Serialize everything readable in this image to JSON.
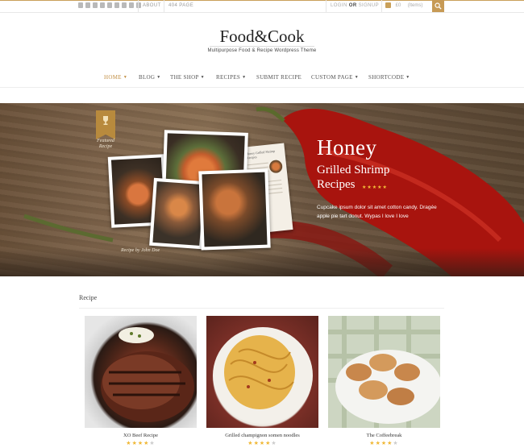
{
  "topbar": {
    "social_icons": [
      "rss-icon",
      "linkedin-icon",
      "pinterest-icon",
      "twitter-icon",
      "facebook-icon",
      "youtube-icon",
      "email-icon",
      "flickr-icon",
      "googleplus-icon"
    ],
    "links": [
      "ABOUT",
      "404 PAGE"
    ],
    "login": "LOGIN",
    "or": "OR",
    "signup": "SIGNUP",
    "cart_amount": "£0",
    "cart_items": "(Items)",
    "accent": "#c79a55"
  },
  "brand": {
    "logo": "Food&Cook",
    "tagline": "Multipurpose Food & Recipe Wordpress Theme"
  },
  "nav": [
    {
      "label": "HOME",
      "caret": true,
      "active": true
    },
    {
      "label": "BLOG",
      "caret": true
    },
    {
      "label": "THE SHOP",
      "caret": true
    },
    {
      "label": "RECIPES",
      "caret": true
    },
    {
      "label": "SUBMIT RECIPE",
      "caret": false
    },
    {
      "label": "CUSTOM PAGE",
      "caret": true
    },
    {
      "label": "SHORTCODE",
      "caret": true
    }
  ],
  "hero": {
    "badge_label": "Featured Recipe",
    "credit": "Recipe by John Doe",
    "title": "Honey",
    "subtitle_1": "Grilled Shrimp",
    "subtitle_2": "Recipes",
    "rating": 5,
    "description": "Cupcake ipsum dolor sit amet cotton candy. Dragée apple pie tart donut. Wypas I love I love",
    "card_title": "Honey Grilled Shrimp Recipes"
  },
  "recipes": {
    "section_title": "Recipe",
    "items": [
      {
        "name": "XO Beef Recipe",
        "rating": 4
      },
      {
        "name": "Grilled champignon somen noodles",
        "rating": 4
      },
      {
        "name": "The Coffeebreak",
        "rating": 4
      }
    ]
  }
}
